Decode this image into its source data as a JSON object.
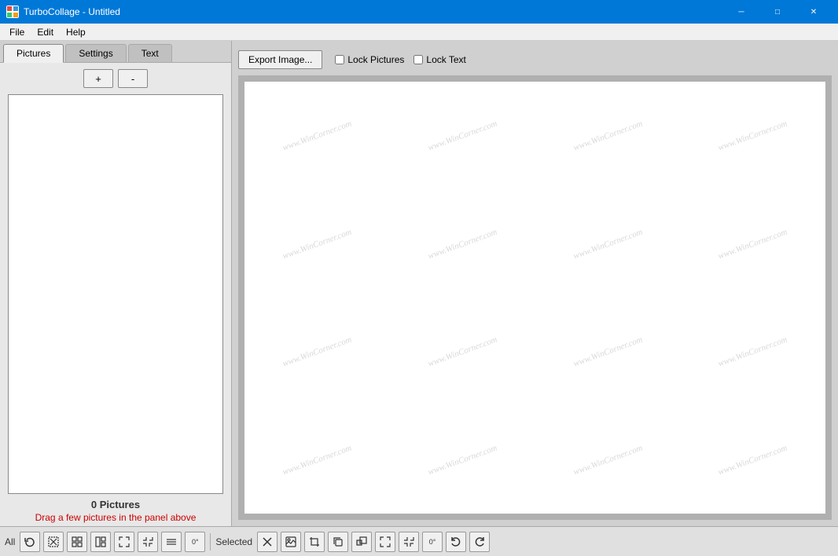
{
  "window": {
    "title": "TurboCollage - Untitled",
    "app_name": "TurboCollage",
    "doc_name": "Untitled"
  },
  "title_bar": {
    "minimize_label": "─",
    "maximize_label": "□",
    "close_label": "✕"
  },
  "menu": {
    "items": [
      "File",
      "Edit",
      "Help"
    ]
  },
  "left_panel": {
    "tabs": [
      "Pictures",
      "Settings",
      "Text"
    ],
    "active_tab": "Pictures",
    "add_button": "+",
    "remove_button": "-",
    "pictures_count": "0 Pictures",
    "pictures_hint": "Drag a few pictures in the panel above"
  },
  "toolbar": {
    "export_button": "Export Image...",
    "lock_pictures_label": "Lock Pictures",
    "lock_text_label": "Lock Text"
  },
  "canvas": {
    "watermark": "www.WinCorner.com"
  },
  "bottom_toolbar": {
    "all_label": "All",
    "selected_label": "Selected",
    "buttons_all": [
      {
        "name": "reset-all",
        "icon": "↺"
      },
      {
        "name": "select-all",
        "icon": "⊠"
      },
      {
        "name": "grid-layout",
        "icon": "⊞"
      },
      {
        "name": "mosaic-layout",
        "icon": "⊟"
      },
      {
        "name": "expand-all",
        "icon": "⤢"
      },
      {
        "name": "compress-all",
        "icon": "⤡"
      },
      {
        "name": "align-horiz",
        "icon": "═"
      },
      {
        "name": "rotate-all",
        "icon": "0°"
      }
    ],
    "buttons_selected": [
      {
        "name": "delete-selected",
        "icon": "✕"
      },
      {
        "name": "image-selected",
        "icon": "▣"
      },
      {
        "name": "crop-selected",
        "icon": "⊡"
      },
      {
        "name": "duplicate-selected",
        "icon": "❐"
      },
      {
        "name": "move-front",
        "icon": "◨"
      },
      {
        "name": "expand-selected",
        "icon": "⤢"
      },
      {
        "name": "compress-selected",
        "icon": "⤡"
      },
      {
        "name": "rotate-selected",
        "icon": "0°"
      },
      {
        "name": "undo",
        "icon": "↺"
      },
      {
        "name": "redo",
        "icon": "↻"
      }
    ]
  }
}
